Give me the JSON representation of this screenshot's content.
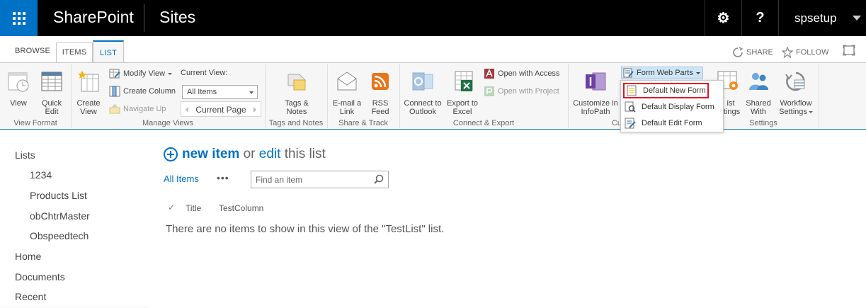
{
  "suitebar": {
    "brand": "SharePoint",
    "section": "Sites",
    "settings_glyph": "⚙",
    "help_glyph": "?",
    "user": "spsetup"
  },
  "tabs": {
    "browse": "BROWSE",
    "items": "ITEMS",
    "list": "LIST",
    "share": "SHARE",
    "follow": "FOLLOW"
  },
  "ribbon": {
    "view_format": {
      "label": "View Format",
      "view": "View",
      "quick_edit": [
        "Quick",
        "Edit"
      ]
    },
    "manage_views": {
      "label": "Manage Views",
      "create_view": [
        "Create",
        "View"
      ],
      "modify_view": "Modify View",
      "create_column": "Create Column",
      "navigate_up": "Navigate Up",
      "current_view_label": "Current View:",
      "current_view_value": "All Items",
      "current_page": "Current Page"
    },
    "tags_notes": {
      "label": "Tags and Notes",
      "button": [
        "Tags &",
        "Notes"
      ]
    },
    "share_track": {
      "label": "Share & Track",
      "email": [
        "E-mail a",
        "Link"
      ],
      "rss": [
        "RSS",
        "Feed"
      ]
    },
    "connect_export": {
      "label": "Connect & Export",
      "outlook": [
        "Connect to",
        "Outlook"
      ],
      "excel": [
        "Export to",
        "Excel"
      ],
      "access": "Open with Access",
      "project": "Open with Project"
    },
    "customize": {
      "label_partial": "Cu",
      "infopath": [
        "Customize in",
        "InfoPath"
      ],
      "form_web_parts": "Form Web Parts"
    },
    "settings": {
      "label": "Settings",
      "list_settings": [
        "ist",
        "ttings"
      ],
      "shared_with": [
        "Shared",
        "With"
      ],
      "workflow": [
        "Workflow",
        "Settings"
      ]
    }
  },
  "form_menu": {
    "items": [
      "Default New Form",
      "Default Display Form",
      "Default Edit Form"
    ]
  },
  "leftnav": {
    "lists": "Lists",
    "sub": [
      "1234",
      "Products List",
      "obChtrMaster",
      "Obspeedtech"
    ],
    "home": "Home",
    "documents": "Documents",
    "recent": "Recent"
  },
  "main": {
    "new_item": "new item",
    "or": "or",
    "edit": "edit",
    "this_list": "this list",
    "all_items": "All Items",
    "ellipsis": "•••",
    "search_placeholder": "Find an item",
    "columns": [
      "Title",
      "TestColumn"
    ],
    "empty_message": "There are no items to show in this view of the \"TestList\" list."
  },
  "colors": {
    "accent": "#0072c6",
    "suitebar": "#000000",
    "highlight_border": "#e81123"
  }
}
